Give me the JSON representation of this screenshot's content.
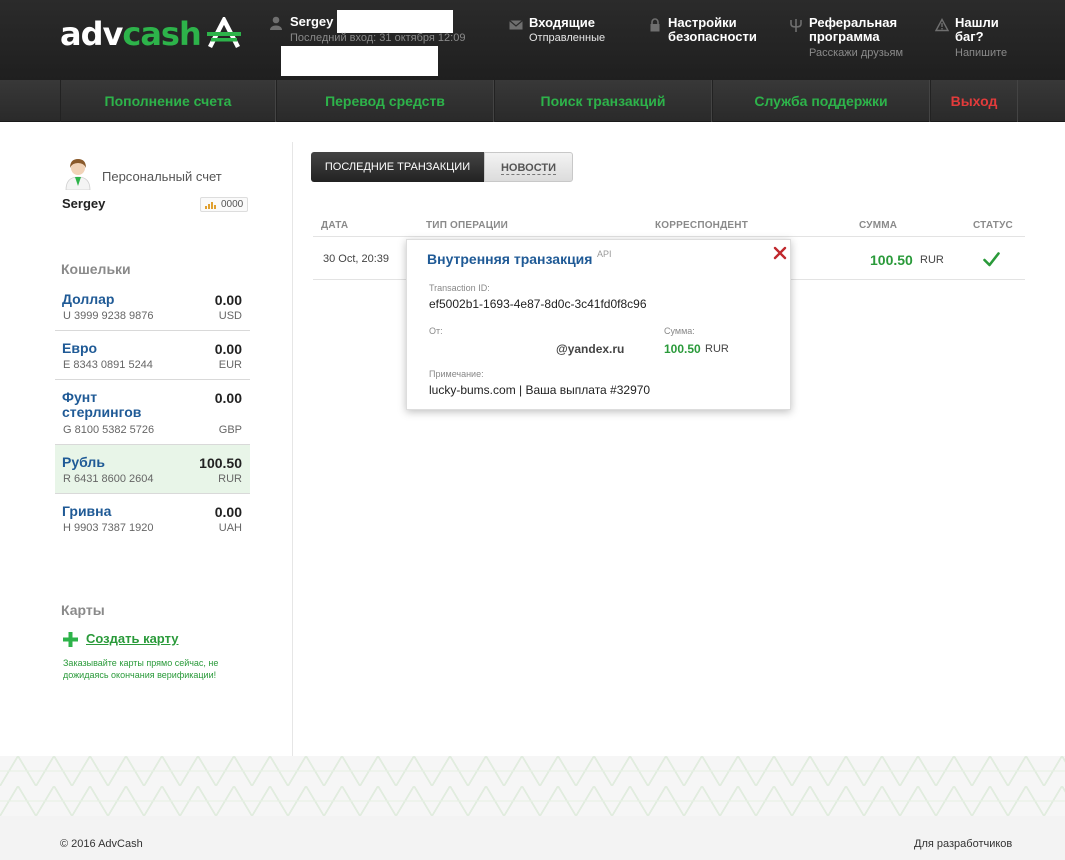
{
  "logo": {
    "part1": "adv",
    "part2": "cash"
  },
  "user": {
    "name": "Sergey",
    "last_login": "Последний вход: 31 октября 12:09"
  },
  "header_links": [
    {
      "title": "Входящие",
      "sub": "Отправленные",
      "icon": "envelope-icon"
    },
    {
      "title": "Настройки",
      "title2": "безопасности",
      "icon": "lock-icon"
    },
    {
      "title": "Реферальная",
      "title2": "программа",
      "sub": "Расскажи друзьям",
      "icon": "trident-icon"
    },
    {
      "title": "Нашли",
      "title2": "баг?",
      "sub": "Напишите",
      "icon": "warning-icon"
    }
  ],
  "nav": [
    {
      "label": "Пополнение счета"
    },
    {
      "label": "Перевод средств"
    },
    {
      "label": "Поиск транзакций"
    },
    {
      "label": "Служба поддержки"
    },
    {
      "label": "Выход"
    }
  ],
  "account": {
    "label": "Персональный счет",
    "user": "Sergey",
    "badge": "0000"
  },
  "wallets_title": "Кошельки",
  "wallets": [
    {
      "name": "Доллар",
      "amount": "0.00",
      "number": "U 3999 9238 9876",
      "currency": "USD"
    },
    {
      "name": "Евро",
      "amount": "0.00",
      "number": "E 8343 0891 5244",
      "currency": "EUR"
    },
    {
      "name": "Фунт",
      "name2": "стерлингов",
      "amount": "0.00",
      "number": "G 8100 5382 5726",
      "currency": "GBP"
    },
    {
      "name": "Рубль",
      "amount": "100.50",
      "number": "R 6431 8600 2604",
      "currency": "RUR"
    },
    {
      "name": "Гривна",
      "amount": "0.00",
      "number": "H 9903 7387 1920",
      "currency": "UAH"
    }
  ],
  "cards": {
    "title": "Карты",
    "create_label": "Создать карту",
    "note": "Заказывайте карты прямо сейчас, не дожидаясь окончания верификации!"
  },
  "tabs": [
    {
      "label": "ПОСЛЕДНИЕ ТРАНЗАКЦИИ"
    },
    {
      "label": "НОВОСТИ"
    }
  ],
  "table": {
    "headers": [
      "ДАТА",
      "ТИП ОПЕРАЦИИ",
      "КОРРЕСПОНДЕНТ",
      "СУММА",
      "СТАТУС"
    ],
    "rows": [
      {
        "date": "30 Oct, 20:39",
        "amount": "100.50",
        "currency": "RUR",
        "status": "check-icon"
      }
    ]
  },
  "popup": {
    "title": "Внутренняя транзакция",
    "api": "API",
    "tx_label": "Transaction ID:",
    "tx_id": "ef5002b1-1693-4e87-8d0c-3c41fd0f8c96",
    "from_label": "От:",
    "from_value": "@yandex.ru",
    "sum_label": "Сумма:",
    "sum_value": "100.50",
    "sum_currency": "RUR",
    "note_label": "Примечание:",
    "note_value": "lucky-bums.com | Ваша выплата #32970"
  },
  "footer": {
    "copyright": "© 2016 AdvCash",
    "dev_link": "Для разработчиков"
  },
  "colors": {
    "accent_green": "#2db34a",
    "link_blue": "#1f5a96",
    "logout_red": "#e23b3b",
    "header_bg": "#252525"
  }
}
